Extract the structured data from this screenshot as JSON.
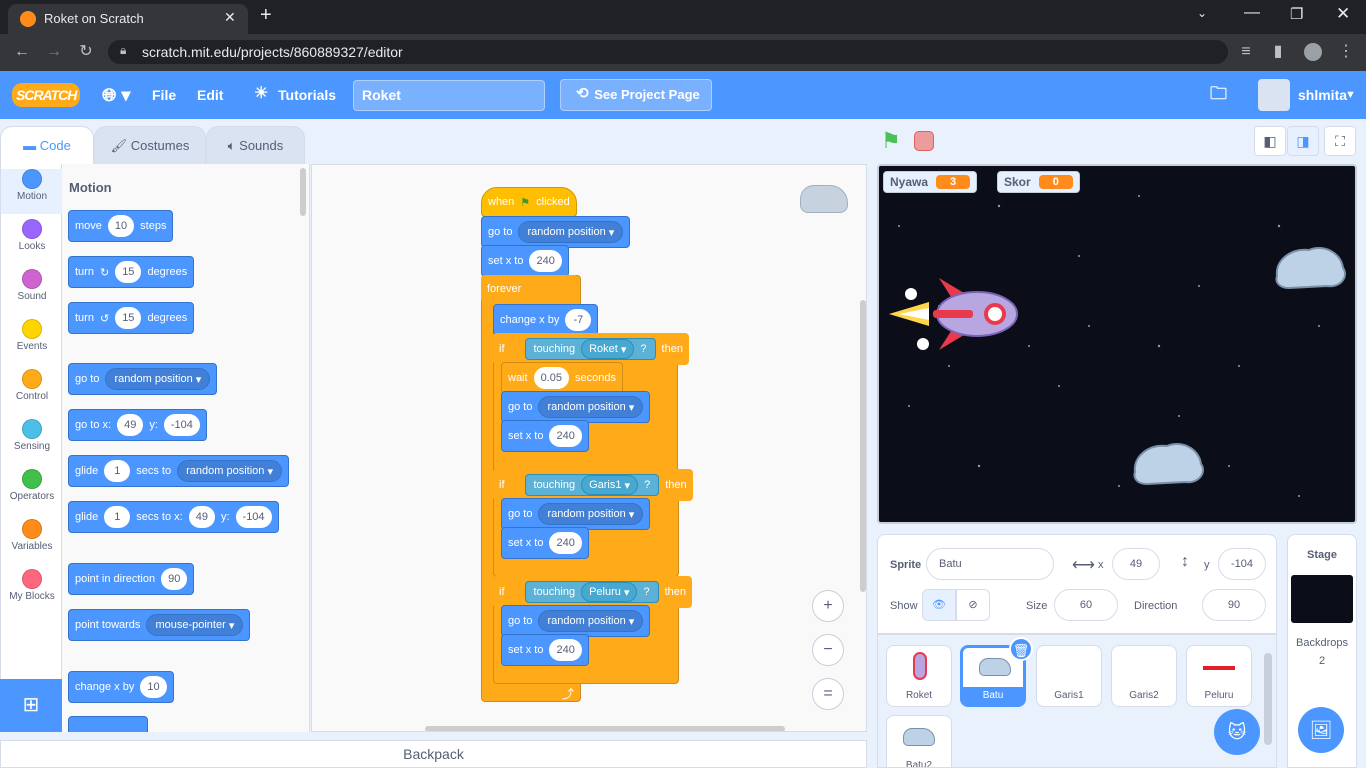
{
  "browser": {
    "tab_title": "Roket on Scratch",
    "url": "scratch.mit.edu/projects/860889327/editor"
  },
  "menubar": {
    "logo": "SCRATCH",
    "file": "File",
    "edit": "Edit",
    "tutorials": "Tutorials",
    "project_title": "Roket",
    "see_project": "See Project Page",
    "username": "shlmita"
  },
  "editor_tabs": {
    "code": "Code",
    "costumes": "Costumes",
    "sounds": "Sounds"
  },
  "categories": [
    {
      "label": "Motion",
      "color": "#4c97ff"
    },
    {
      "label": "Looks",
      "color": "#9966ff"
    },
    {
      "label": "Sound",
      "color": "#cf63cf"
    },
    {
      "label": "Events",
      "color": "#ffd500"
    },
    {
      "label": "Control",
      "color": "#ffab19"
    },
    {
      "label": "Sensing",
      "color": "#4cbfe6"
    },
    {
      "label": "Operators",
      "color": "#40bf4a"
    },
    {
      "label": "Variables",
      "color": "#ff8c1a"
    },
    {
      "label": "My Blocks",
      "color": "#ff6680"
    }
  ],
  "palette": {
    "heading": "Motion",
    "move": {
      "a": "move",
      "v": "10",
      "b": "steps"
    },
    "turn_right": {
      "a": "turn",
      "v": "15",
      "b": "degrees"
    },
    "turn_left": {
      "a": "turn",
      "v": "15",
      "b": "degrees"
    },
    "goto": {
      "a": "go to",
      "d": "random position"
    },
    "gotoxy": {
      "a": "go to x:",
      "x": "49",
      "b": "y:",
      "y": "-104"
    },
    "glide": {
      "a": "glide",
      "v": "1",
      "b": "secs to",
      "d": "random position"
    },
    "glidexy": {
      "a": "glide",
      "v": "1",
      "b": "secs to x:",
      "x": "49",
      "c": "y:",
      "y": "-104"
    },
    "pointdir": {
      "a": "point in direction",
      "v": "90"
    },
    "pointtowards": {
      "a": "point towards",
      "d": "mouse-pointer"
    },
    "changex": {
      "a": "change x by",
      "v": "10"
    }
  },
  "script": {
    "when": "when",
    "clicked": "clicked",
    "goto": "go to",
    "random": "random position",
    "setx": "set x to",
    "setx_v": "240",
    "forever": "forever",
    "changex": "change x by",
    "changex_v": "-7",
    "if": "if",
    "then": "then",
    "touching": "touching",
    "q": "?",
    "t1": "Roket",
    "t2": "Garis1",
    "t3": "Peluru",
    "wait": "wait",
    "wait_v": "0.05",
    "seconds": "seconds"
  },
  "zoom": {
    "in": "+",
    "out": "−",
    "reset": "="
  },
  "backpack": "Backpack",
  "stage": {
    "monitors": [
      {
        "label": "Nyawa",
        "value": "3"
      },
      {
        "label": "Skor",
        "value": "0"
      }
    ]
  },
  "sprite_info": {
    "sprite_label": "Sprite",
    "sprite_name": "Batu",
    "x_label": "x",
    "x": "49",
    "y_label": "y",
    "y": "-104",
    "show_label": "Show",
    "size_label": "Size",
    "size": "60",
    "direction_label": "Direction",
    "direction": "90"
  },
  "sprites": [
    "Roket",
    "Batu",
    "Garis1",
    "Garis2",
    "Peluru",
    "Batu2"
  ],
  "stage_panel": {
    "title": "Stage",
    "backdrops_label": "Backdrops",
    "backdrops_count": "2"
  }
}
